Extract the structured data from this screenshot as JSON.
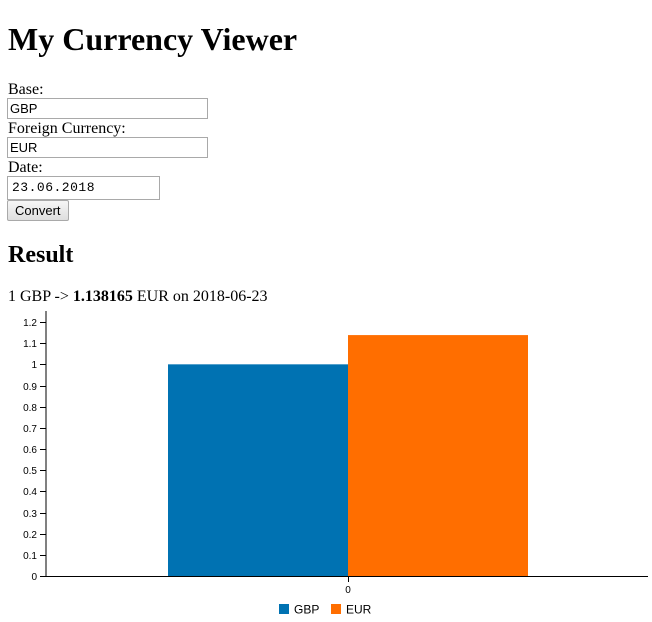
{
  "title": "My Currency Viewer",
  "form": {
    "base_label": "Base:",
    "base_value": "GBP",
    "foreign_label": "Foreign Currency:",
    "foreign_value": "EUR",
    "date_label": "Date:",
    "date_value": "23.06.2018",
    "convert_label": "Convert"
  },
  "result": {
    "heading": "Result",
    "prefix": "1 GBP ->",
    "rate": "1.138165",
    "suffix": "EUR on 2018-06-23"
  },
  "chart_data": {
    "type": "bar",
    "categories": [
      "0"
    ],
    "series": [
      {
        "name": "GBP",
        "values": [
          1
        ],
        "color": "#0072b2"
      },
      {
        "name": "EUR",
        "values": [
          1.138165
        ],
        "color": "#ff6e00"
      }
    ],
    "xlabel": "",
    "ylabel": "",
    "ylim": [
      0,
      1.2
    ],
    "yticks": [
      "0",
      "0.1",
      "0.2",
      "0.3",
      "0.4",
      "0.5",
      "0.6",
      "0.7",
      "0.8",
      "0.9",
      "1",
      "1.1",
      "1.2"
    ],
    "grid": false,
    "legend": "bottom"
  }
}
